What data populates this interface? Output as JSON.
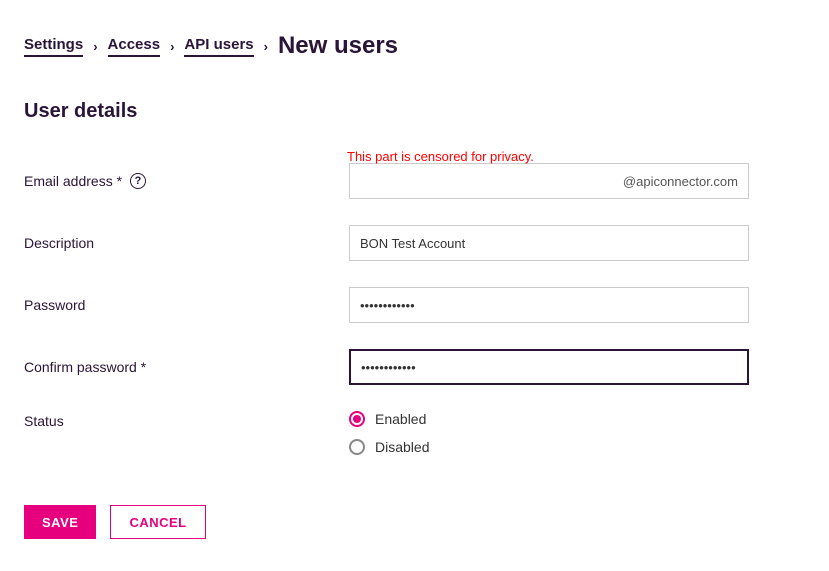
{
  "breadcrumb": {
    "items": [
      "Settings",
      "Access",
      "API users"
    ],
    "current": "New users"
  },
  "section_title": "User details",
  "censored_note": "This part is censored for privacy.",
  "fields": {
    "email": {
      "label": "Email address *",
      "suffix": "@apiconnector.com"
    },
    "description": {
      "label": "Description",
      "value": "BON Test Account"
    },
    "password": {
      "label": "Password",
      "value": "••••••••••••"
    },
    "confirm_password": {
      "label": "Confirm password *",
      "value": "••••••••••••"
    },
    "status": {
      "label": "Status",
      "options": {
        "enabled": "Enabled",
        "disabled": "Disabled"
      },
      "selected": "enabled"
    }
  },
  "buttons": {
    "save": "SAVE",
    "cancel": "CANCEL"
  }
}
